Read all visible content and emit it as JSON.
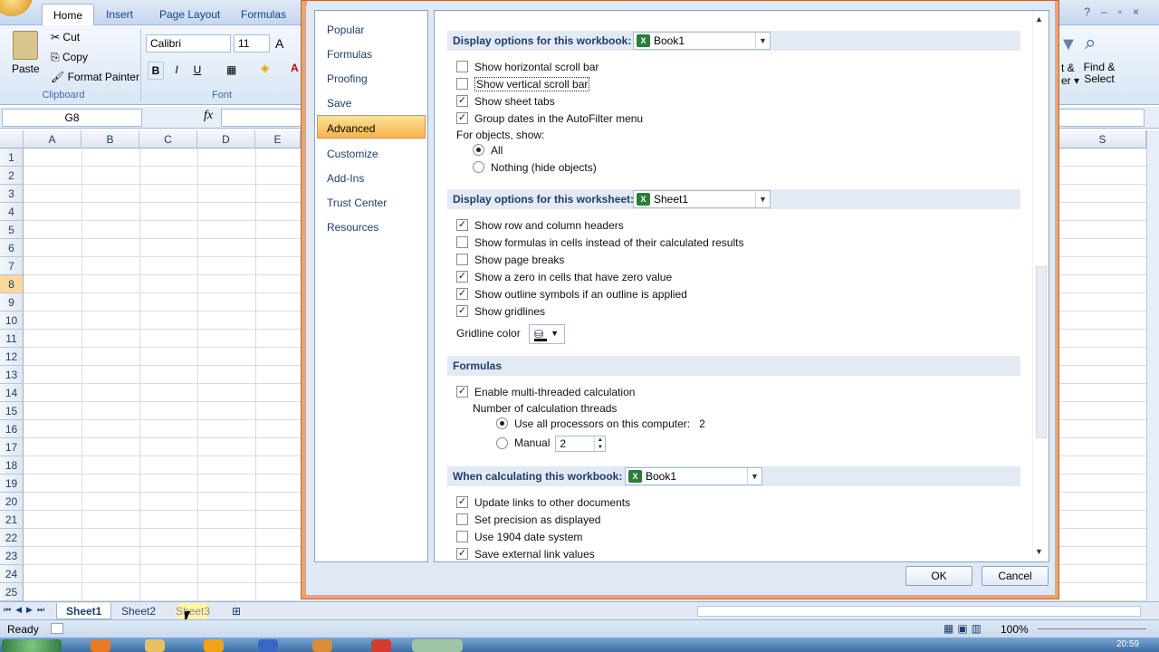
{
  "ribbon": {
    "tabs": [
      "Home",
      "Insert",
      "Page Layout",
      "Formulas"
    ],
    "clipboard": {
      "paste": "Paste",
      "cut": "Cut",
      "copy": "Copy",
      "format_painter": "Format Painter",
      "label": "Clipboard"
    },
    "font": {
      "name": "Calibri",
      "size": "11",
      "label": "Font",
      "bold": "B",
      "italic": "I",
      "underline": "U"
    },
    "right": {
      "find_select": "Find & Select",
      "frag1": "t &",
      "frag2": "er"
    }
  },
  "formula_bar": {
    "name_box": "G8",
    "fx": "fx"
  },
  "grid": {
    "columns": [
      "A",
      "B",
      "C",
      "D",
      "E"
    ],
    "right_column": "S",
    "rows": [
      "1",
      "2",
      "3",
      "4",
      "5",
      "6",
      "7",
      "8",
      "9",
      "10",
      "11",
      "12",
      "13",
      "14",
      "15",
      "16",
      "17",
      "18",
      "19",
      "20",
      "21",
      "22",
      "23",
      "24",
      "25"
    ],
    "selected_row": "8"
  },
  "sheets": [
    "Sheet1",
    "Sheet2",
    "Sheet3"
  ],
  "status": {
    "ready": "Ready",
    "zoom": "100%"
  },
  "taskbar": {
    "time": "20:59"
  },
  "dialog": {
    "nav": [
      "Popular",
      "Formulas",
      "Proofing",
      "Save",
      "Advanced",
      "Customize",
      "Add-Ins",
      "Trust Center",
      "Resources"
    ],
    "active_nav": "Advanced",
    "workbook_section": {
      "title": "Display options for this workbook:",
      "workbook": "Book1",
      "items": [
        {
          "label": "Show horizontal scroll bar",
          "checked": false
        },
        {
          "label": "Show vertical scroll bar",
          "checked": false
        },
        {
          "label": "Show sheet tabs",
          "checked": true
        },
        {
          "label": "Group dates in the AutoFilter menu",
          "checked": true
        }
      ],
      "objects_label": "For objects, show:",
      "objects_all": "All",
      "objects_nothing": "Nothing (hide objects)"
    },
    "worksheet_section": {
      "title": "Display options for this worksheet:",
      "sheet": "Sheet1",
      "items": [
        {
          "label": "Show row and column headers",
          "checked": true
        },
        {
          "label": "Show formulas in cells instead of their calculated results",
          "checked": false
        },
        {
          "label": "Show page breaks",
          "checked": false
        },
        {
          "label": "Show a zero in cells that have zero value",
          "checked": true
        },
        {
          "label": "Show outline symbols if an outline is applied",
          "checked": true
        },
        {
          "label": "Show gridlines",
          "checked": true
        }
      ],
      "gridline_color": "Gridline color"
    },
    "formulas_section": {
      "title": "Formulas",
      "multithread": "Enable multi-threaded calculation",
      "threads_label": "Number of calculation threads",
      "use_all": "Use all processors on this computer:",
      "processors": "2",
      "manual": "Manual",
      "manual_value": "2"
    },
    "calc_section": {
      "title": "When calculating this workbook:",
      "workbook": "Book1",
      "items": [
        {
          "label": "Update links to other documents",
          "checked": true
        },
        {
          "label": "Set precision as displayed",
          "checked": false
        },
        {
          "label": "Use 1904 date system",
          "checked": false
        },
        {
          "label": "Save external link values",
          "checked": true
        }
      ]
    },
    "ok": "OK",
    "cancel": "Cancel"
  }
}
